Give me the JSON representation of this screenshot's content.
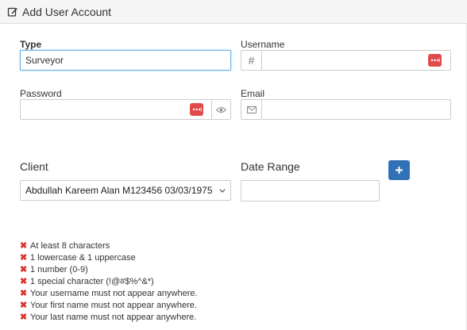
{
  "header": {
    "title": "Add User Account",
    "icon": "edit-icon"
  },
  "form": {
    "type": {
      "label": "Type",
      "value": "Surveyor"
    },
    "username": {
      "label": "Username",
      "prefix": "#",
      "value": ""
    },
    "password": {
      "label": "Password",
      "value": ""
    },
    "email": {
      "label": "Email",
      "value": ""
    },
    "client": {
      "label": "Client",
      "selected": "Abdullah Kareem Alan M123456 03/03/1975"
    },
    "date_range": {
      "label": "Date Range",
      "value": ""
    }
  },
  "password_rules": [
    "At least 8 characters",
    "1 lowercase & 1 uppercase",
    "1 number (0-9)",
    "1 special character (!@#$%^&*)",
    "Your username must not appear anywhere.",
    "Your first name must not appear anywhere.",
    "Your last name must not appear anywhere."
  ],
  "colors": {
    "accent": "#3072b5",
    "error": "#d9332f",
    "badge": "#e04a4a",
    "focus": "#66afe9"
  }
}
